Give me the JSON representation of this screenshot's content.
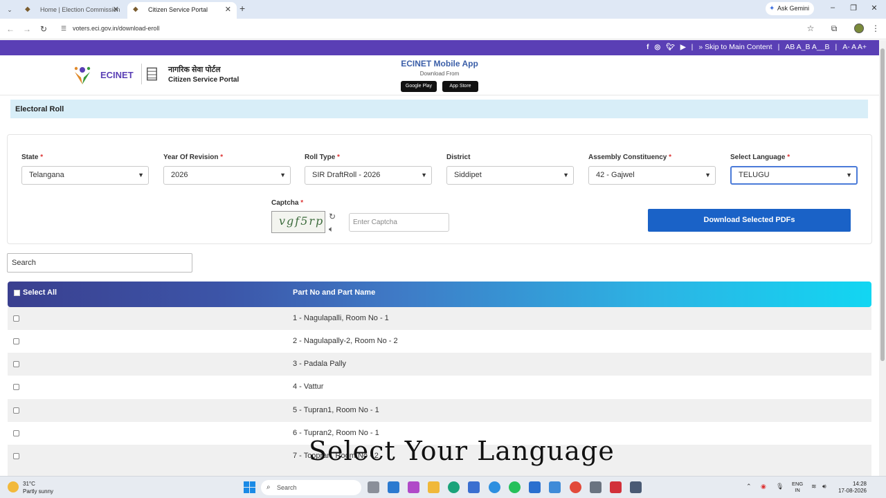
{
  "browser": {
    "tabs": [
      {
        "title": "Home | Election Commission of",
        "active": false
      },
      {
        "title": "Citizen Service Portal",
        "active": true
      }
    ],
    "gemini": "Ask Gemini",
    "url": "voters.eci.gov.in/download-eroll"
  },
  "site": {
    "topbar": {
      "skip": "» Skip to Main Content",
      "contrast": "AB A_B A__B",
      "fontsize": "A- A A+"
    },
    "brand": {
      "ecinet": "ECINET",
      "portal_hindi": "नागरिक सेवा पोर्टल",
      "portal_english": "Citizen Service Portal"
    },
    "app": {
      "title": "ECINET Mobile App",
      "download_from": "Download From",
      "google_play": "Google Play",
      "app_store": "App Store"
    },
    "section_title": "Electoral Roll"
  },
  "form": {
    "fields": [
      {
        "label": "State",
        "required": true,
        "value": "Telangana"
      },
      {
        "label": "Year Of Revision",
        "required": true,
        "value": "2026"
      },
      {
        "label": "Roll Type",
        "required": true,
        "value": "SIR DraftRoll - 2026"
      },
      {
        "label": "District",
        "required": false,
        "value": "Siddipet"
      },
      {
        "label": "Assembly Constituency",
        "required": true,
        "value": "42 - Gajwel"
      },
      {
        "label": "Select Language",
        "required": true,
        "value": "TELUGU"
      }
    ],
    "captcha_label": "Captcha",
    "captcha_text": "vgf5rp",
    "captcha_placeholder": "Enter Captcha",
    "download_button": "Download Selected PDFs"
  },
  "search_placeholder": "Search",
  "table": {
    "select_all": "Select All",
    "column": "Part No and Part Name",
    "rows": [
      "1 - Nagulapalli, Room No - 1",
      "2 - Nagulapally-2, Room No - 2",
      "3 - Padala Pally",
      "4 - Vattur",
      "5 - Tupran1, Room No - 1",
      "6 - Tupran2, Room No - 1",
      "7 - Toopran, Room No - 2"
    ]
  },
  "caption": "Select Your Language",
  "taskbar": {
    "temp": "31°C",
    "weather": "Partly sunny",
    "search": "Search",
    "lang1": "ENG",
    "lang2": "IN",
    "time": "14:28",
    "date": "17-08-2026"
  },
  "colors": {
    "purple": "#5a3fb5",
    "primary_button": "#1a62c7",
    "band": "#d8eef8"
  }
}
